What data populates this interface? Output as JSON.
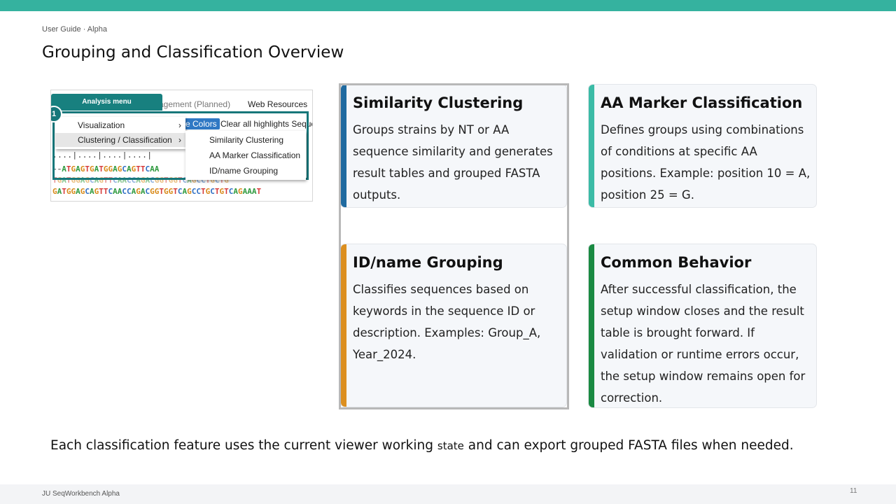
{
  "header": {
    "breadcrumb": "User Guide · Alpha",
    "title": "Grouping and Classification Overview",
    "accent_color": "#35b29f"
  },
  "screenshot": {
    "menubar": {
      "item_partial": "agement (Planned)",
      "web_resources": "Web Resources"
    },
    "toolbar": {
      "colors_button": "e Colors",
      "clear_highlights": "Clear all highlights Seque"
    },
    "analysis_menu": "Analysis menu",
    "step_badge": "1",
    "menu_items": [
      {
        "label": "Visualization",
        "chevron": "›"
      },
      {
        "label": "Clustering / Classification",
        "chevron": "›"
      }
    ],
    "submenu_items": [
      {
        "label": "Similarity Clustering"
      },
      {
        "label": "AA Marker Classification"
      },
      {
        "label": "ID/name Grouping"
      }
    ],
    "ruler": "....|....|....|....|",
    "sequences": [
      "--ATGAGTGATGGAGCAGTTCAA",
      "    TGATGGAGCAGTTCAACCAGACGGTGGTCAGCCTGCTG",
      "GATGGAGCAGTTCAACCAGACGGTGGTCAGCCTGCTGTCAGAAAT"
    ]
  },
  "cards": [
    {
      "title": "Similarity Clustering",
      "body": "Groups strains by NT or AA sequence similarity and generates result tables and grouped FASTA outputs.",
      "accent": "#1f6aa0"
    },
    {
      "title": "AA Marker Classification",
      "body": "Defines groups using combinations of conditions at specific AA positions. Example: position 10 = A, position 25 = G.",
      "accent": "#3bbba6"
    },
    {
      "title": "ID/name Grouping",
      "body": "Classifies sequences based on keywords in the sequence ID or description. Examples: Group_A, Year_2024.",
      "accent": "#dc8f1f"
    },
    {
      "title": "Common Behavior",
      "body": "After successful classification, the setup window closes and the result table is brought forward. If validation or runtime errors occur, the setup window remains open for correction.",
      "accent": "#1a8a42"
    }
  ],
  "summary": {
    "part1": "Each classification feature uses the current viewer working ",
    "part2": "state",
    "part3": " and can export grouped FASTA files when needed."
  },
  "footer": {
    "label": "JU SeqWorkbench Alpha",
    "page": "11"
  }
}
